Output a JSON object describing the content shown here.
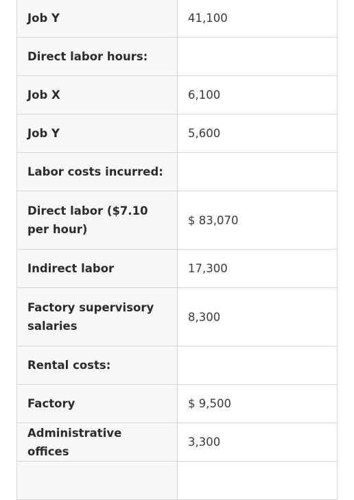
{
  "rows": [
    {
      "label": "Job Y",
      "value": "41,100"
    },
    {
      "label": "Direct labor hours:",
      "value": ""
    },
    {
      "label": "Job X",
      "value": "6,100"
    },
    {
      "label": "Job Y",
      "value": "5,600"
    },
    {
      "label": "Labor costs incurred:",
      "value": ""
    },
    {
      "label": "Direct labor ($7.10 per hour)",
      "value": "$ 83,070"
    },
    {
      "label": "Indirect labor",
      "value": "17,300"
    },
    {
      "label": "Factory supervisory salaries",
      "value": "8,300"
    },
    {
      "label": "Rental costs:",
      "value": ""
    },
    {
      "label": "Factory",
      "value": "$ 9,500"
    },
    {
      "label": "Administrative offices",
      "value": "3,300"
    },
    {
      "label": "",
      "value": ""
    }
  ]
}
